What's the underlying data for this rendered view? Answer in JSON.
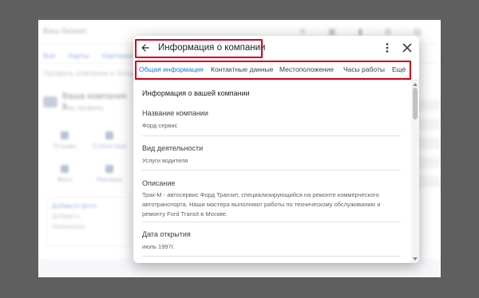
{
  "background": {
    "search_text": "Ваш бизнес",
    "tabs": [
      "Все",
      "Карты",
      "Картинки"
    ],
    "subtitle": "Профиль компании в Google",
    "card_title": "Ваша компания в",
    "card_sub": "Ваш профиль",
    "grid": [
      "Отзывы",
      "Статистика",
      "Фото",
      "Реклама"
    ],
    "box_title": "Добавьте фото",
    "box_link": "Добавить",
    "box_sub": "Изменения"
  },
  "dialog": {
    "title": "Информация о компании",
    "tabs": [
      {
        "label": "Общая информация",
        "active": true
      },
      {
        "label": "Контактные данные",
        "active": false
      },
      {
        "label": "Местоположение",
        "active": false
      },
      {
        "label": "Часы работы",
        "active": false
      },
      {
        "label": "Ещё",
        "active": false
      }
    ],
    "section_title": "Информация о вашей компании",
    "fields": [
      {
        "label": "Название компании",
        "value": "Форд сервис"
      },
      {
        "label": "Вид деятельности",
        "value": "Услуги водителя"
      },
      {
        "label": "Описание",
        "value": "Трак-М - автосервис Форд Транзит, специализирующийся на ремонте коммерческого автотранспорта. Наши мастера выполняют работы по техническому обслуживанию и ремонту Ford Transit в Москве."
      },
      {
        "label": "Дата открытия",
        "value": "июль 1997г."
      }
    ]
  },
  "colors": {
    "accent": "#1a73e8",
    "highlight": "#d0021b",
    "frame": "#5f5f5f"
  },
  "icons": [
    "back-arrow-icon",
    "more-vert-icon",
    "close-icon"
  ]
}
